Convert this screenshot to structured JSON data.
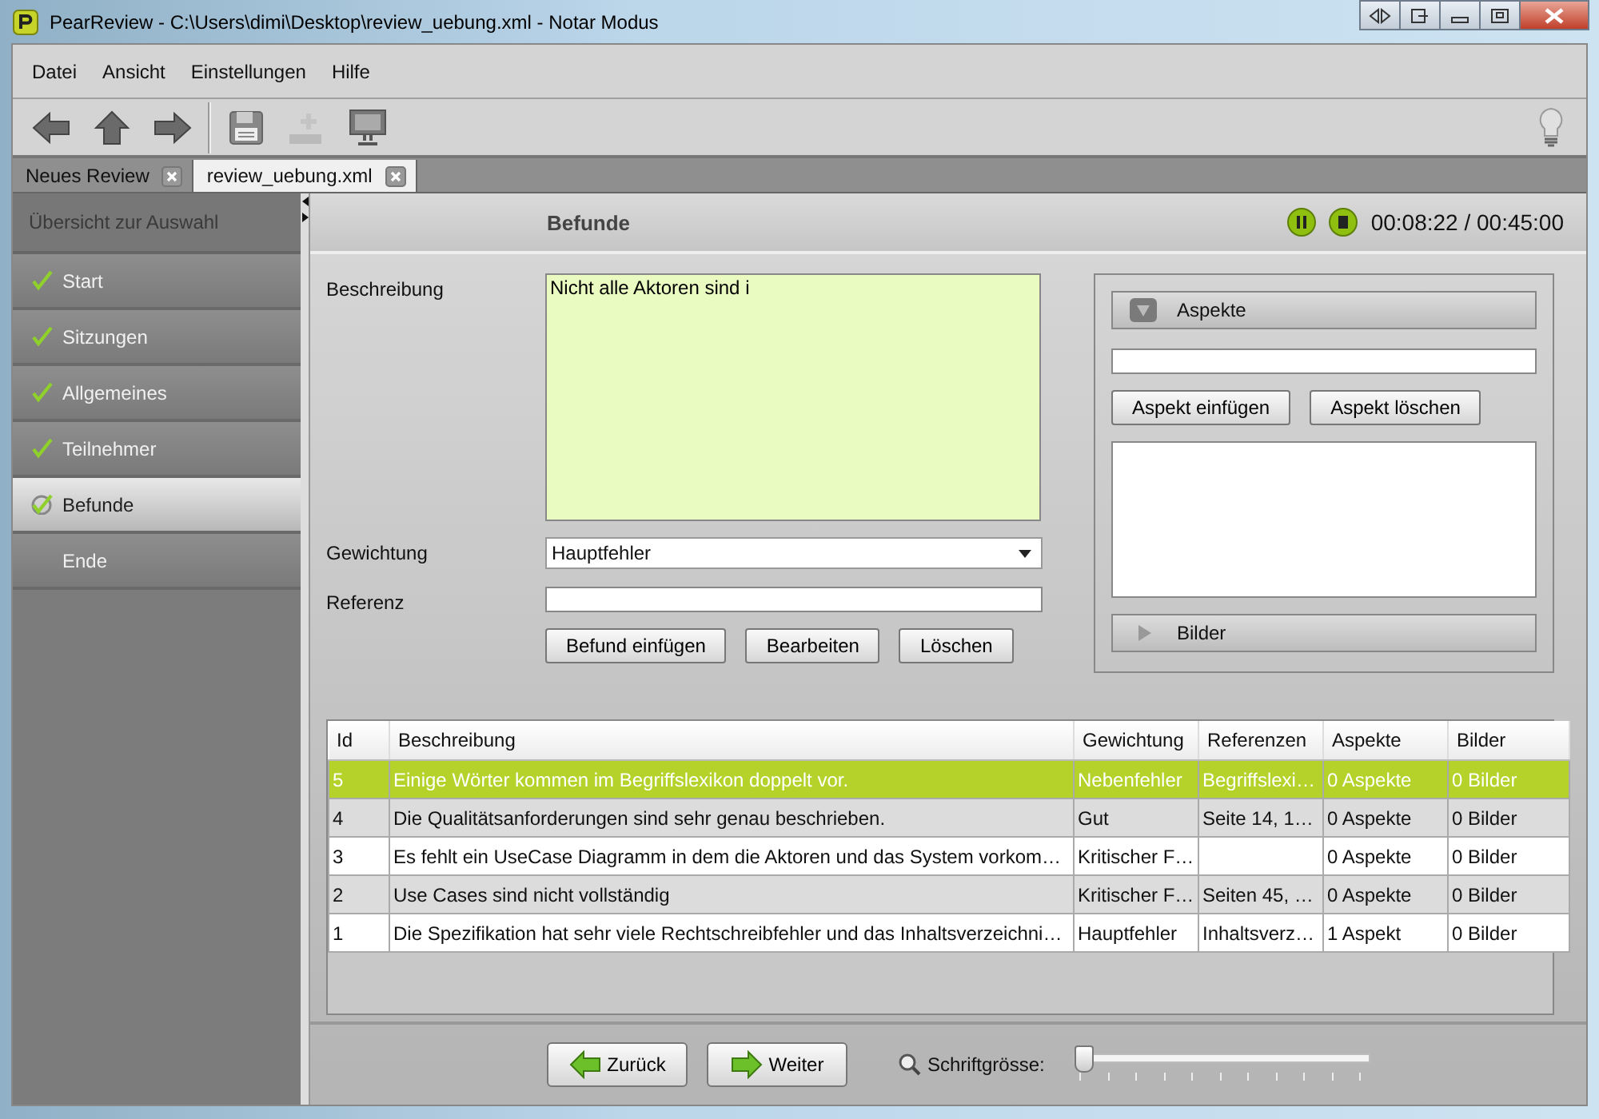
{
  "window": {
    "title": "PearReview - C:\\Users\\dimi\\Desktop\\review_uebung.xml - Notar Modus"
  },
  "menu": [
    "Datei",
    "Ansicht",
    "Einstellungen",
    "Hilfe"
  ],
  "toolbar": [
    {
      "kind": "back",
      "disabled": false
    },
    {
      "kind": "up",
      "disabled": false
    },
    {
      "kind": "forward",
      "disabled": false
    },
    {
      "kind": "save",
      "disabled": false
    },
    {
      "kind": "add",
      "disabled": true
    },
    {
      "kind": "monitor",
      "disabled": false
    }
  ],
  "tabs": [
    {
      "label": "Neues Review",
      "selected": false
    },
    {
      "label": "review_uebung.xml",
      "selected": true
    }
  ],
  "sidebar": {
    "title": "Übersicht zur Auswahl",
    "items": [
      {
        "label": "Start",
        "done": true,
        "selected": false
      },
      {
        "label": "Sitzungen",
        "done": true,
        "selected": false
      },
      {
        "label": "Allgemeines",
        "done": true,
        "selected": false
      },
      {
        "label": "Teilnehmer",
        "done": true,
        "selected": false
      },
      {
        "label": "Befunde",
        "done": true,
        "selected": true
      },
      {
        "label": "Ende",
        "done": false,
        "selected": false
      }
    ]
  },
  "header": {
    "title": "Befunde",
    "timer": "00:08:22 / 00:45:00"
  },
  "form": {
    "description_label": "Beschreibung",
    "description": "Nicht alle Aktoren sind i",
    "weight_label": "Gewichtung",
    "weight": "Hauptfehler",
    "reference_label": "Referenz",
    "buttons": [
      "Befund einfügen",
      "Bearbeiten",
      "Löschen"
    ]
  },
  "aspects": {
    "title": "Aspekte",
    "expanded": true,
    "buttons": [
      "Aspekt einfügen",
      "Aspekt löschen"
    ]
  },
  "images": {
    "title": "Bilder",
    "expanded": false
  },
  "table": {
    "columns": [
      "Id",
      "Beschreibung",
      "Gewichtung",
      "Referenzen",
      "Aspekte",
      "Bilder"
    ],
    "rows": [
      {
        "cells": [
          "5",
          "Einige Wörter kommen im Begriffslexikon doppelt vor.",
          "Nebenfehler",
          "Begriffslexi…",
          "0 Aspekte",
          "0 Bilder"
        ],
        "selected": true
      },
      {
        "cells": [
          "4",
          "Die Qualitätsanforderungen sind sehr genau beschrieben.",
          "Gut",
          "Seite 14, 1…",
          "0 Aspekte",
          "0 Bilder"
        ],
        "selected": false
      },
      {
        "cells": [
          "3",
          "Es fehlt ein UseCase Diagramm in dem die Aktoren und das System vorkom…",
          "Kritischer F…",
          "",
          "0 Aspekte",
          "0 Bilder"
        ],
        "selected": false
      },
      {
        "cells": [
          "2",
          "Use Cases sind nicht vollständig",
          "Kritischer F…",
          "Seiten 45, …",
          "0 Aspekte",
          "0 Bilder"
        ],
        "selected": false
      },
      {
        "cells": [
          "1",
          "Die Spezifikation hat sehr viele Rechtschreibfehler und das Inhaltsverzeichni…",
          "Hauptfehler",
          "Inhaltsverz…",
          "1 Aspekt",
          "0 Bilder"
        ],
        "selected": false
      }
    ]
  },
  "footer": {
    "back": "Zurück",
    "next": "Weiter",
    "font_label": "Schriftgrösse:",
    "font_size": {
      "level": 0
    }
  }
}
